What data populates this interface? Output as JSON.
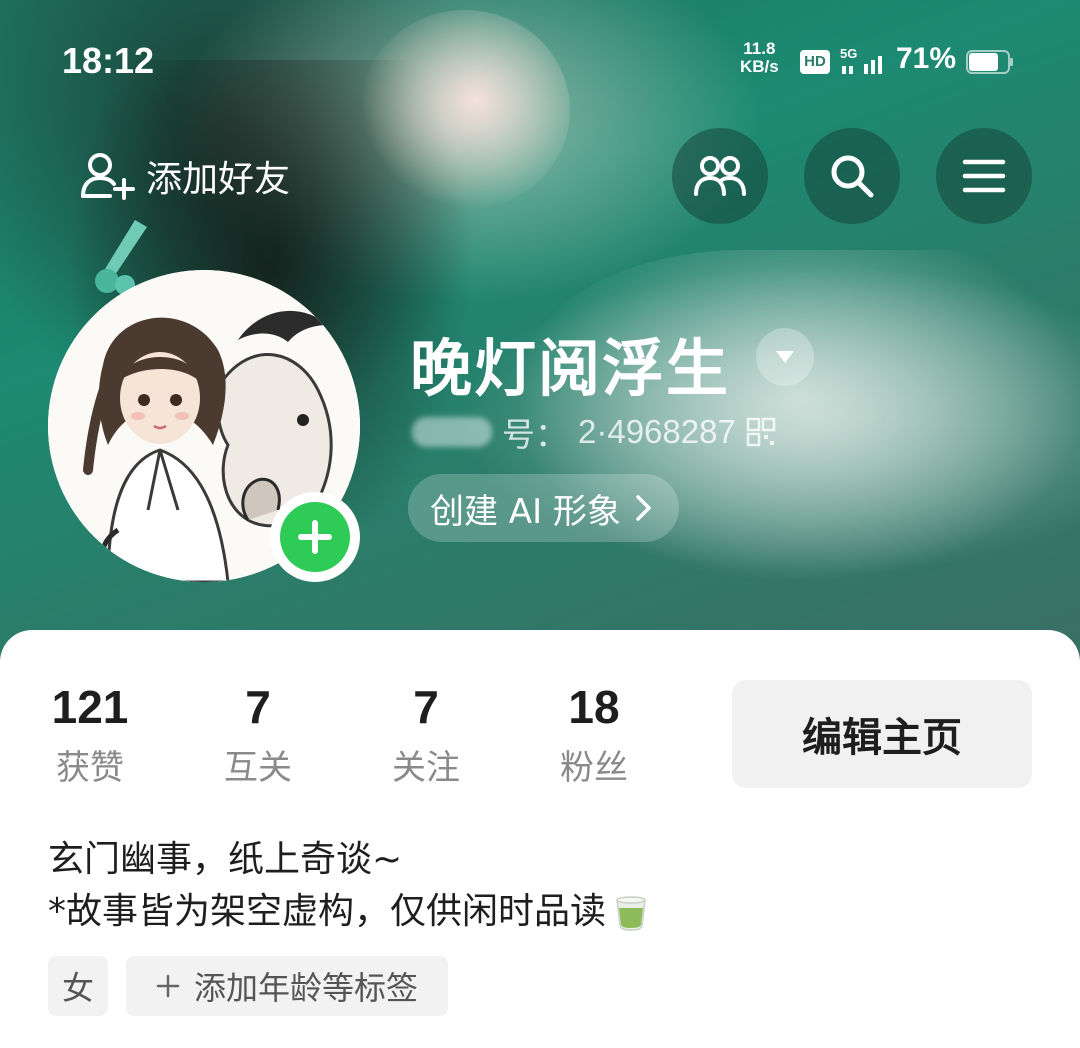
{
  "status_bar": {
    "time": "18:12",
    "net_speed_value": "11.8",
    "net_speed_unit": "KB/s",
    "hd_badge": "HD",
    "network": "5G",
    "battery": "71%"
  },
  "header": {
    "add_friend_label": "添加好友",
    "friends_icon": "friends-icon",
    "search_icon": "search-icon",
    "menu_icon": "menu-icon"
  },
  "profile": {
    "username": "晚灯阅浮生",
    "id_label_suffix": "号：",
    "id_value": "2·4968287",
    "create_ai_label": "创建 AI 形象",
    "stats": [
      {
        "value": "121",
        "label": "获赞"
      },
      {
        "value": "7",
        "label": "互关"
      },
      {
        "value": "7",
        "label": "关注"
      },
      {
        "value": "18",
        "label": "粉丝"
      }
    ],
    "edit_button_label": "编辑主页",
    "bio_line1": "玄门幽事，纸上奇谈~",
    "bio_line2": "*故事皆为架空虚构，仅供闲时品读",
    "tags": {
      "gender": "女",
      "add_tags": "添加年龄等标签"
    }
  },
  "colors": {
    "accent_green": "#2ecc56",
    "hero_green": "#1c8a72"
  }
}
